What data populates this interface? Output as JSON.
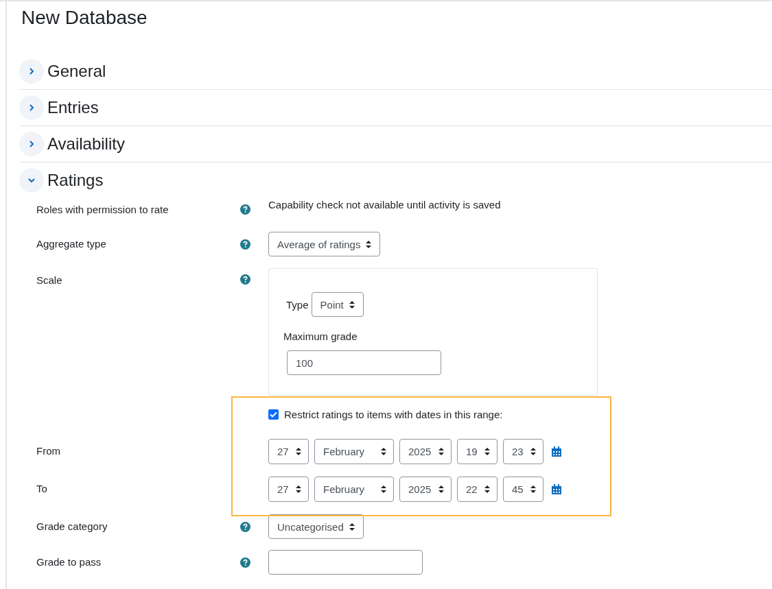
{
  "page": {
    "title": "New Database"
  },
  "sections": [
    {
      "title": "General",
      "expanded": false
    },
    {
      "title": "Entries",
      "expanded": false
    },
    {
      "title": "Availability",
      "expanded": false
    },
    {
      "title": "Ratings",
      "expanded": true
    }
  ],
  "ratings": {
    "rows": [
      {
        "kind": "static",
        "label": "Roles with permission to rate",
        "help": true,
        "value": "Capability check not available until activity is saved"
      },
      {
        "kind": "select",
        "label": "Aggregate type",
        "help": true,
        "value": "Average of ratings"
      },
      {
        "kind": "scale",
        "label": "Scale",
        "help": true,
        "type_label": "Type",
        "type_value": "Point",
        "max_label": "Maximum grade",
        "max_value": "100"
      },
      {
        "kind": "checkbox",
        "label": "Restrict ratings to items with dates in this range:",
        "checked": true
      },
      {
        "kind": "datetime",
        "label": "From",
        "parts": [
          "27",
          "February",
          "2025",
          "19",
          "23"
        ]
      },
      {
        "kind": "datetime",
        "label": "To",
        "parts": [
          "27",
          "February",
          "2025",
          "22",
          "45"
        ]
      },
      {
        "kind": "select",
        "label": "Grade category",
        "help": true,
        "value": "Uncategorised"
      },
      {
        "kind": "input",
        "label": "Grade to pass",
        "help": true
      }
    ]
  }
}
